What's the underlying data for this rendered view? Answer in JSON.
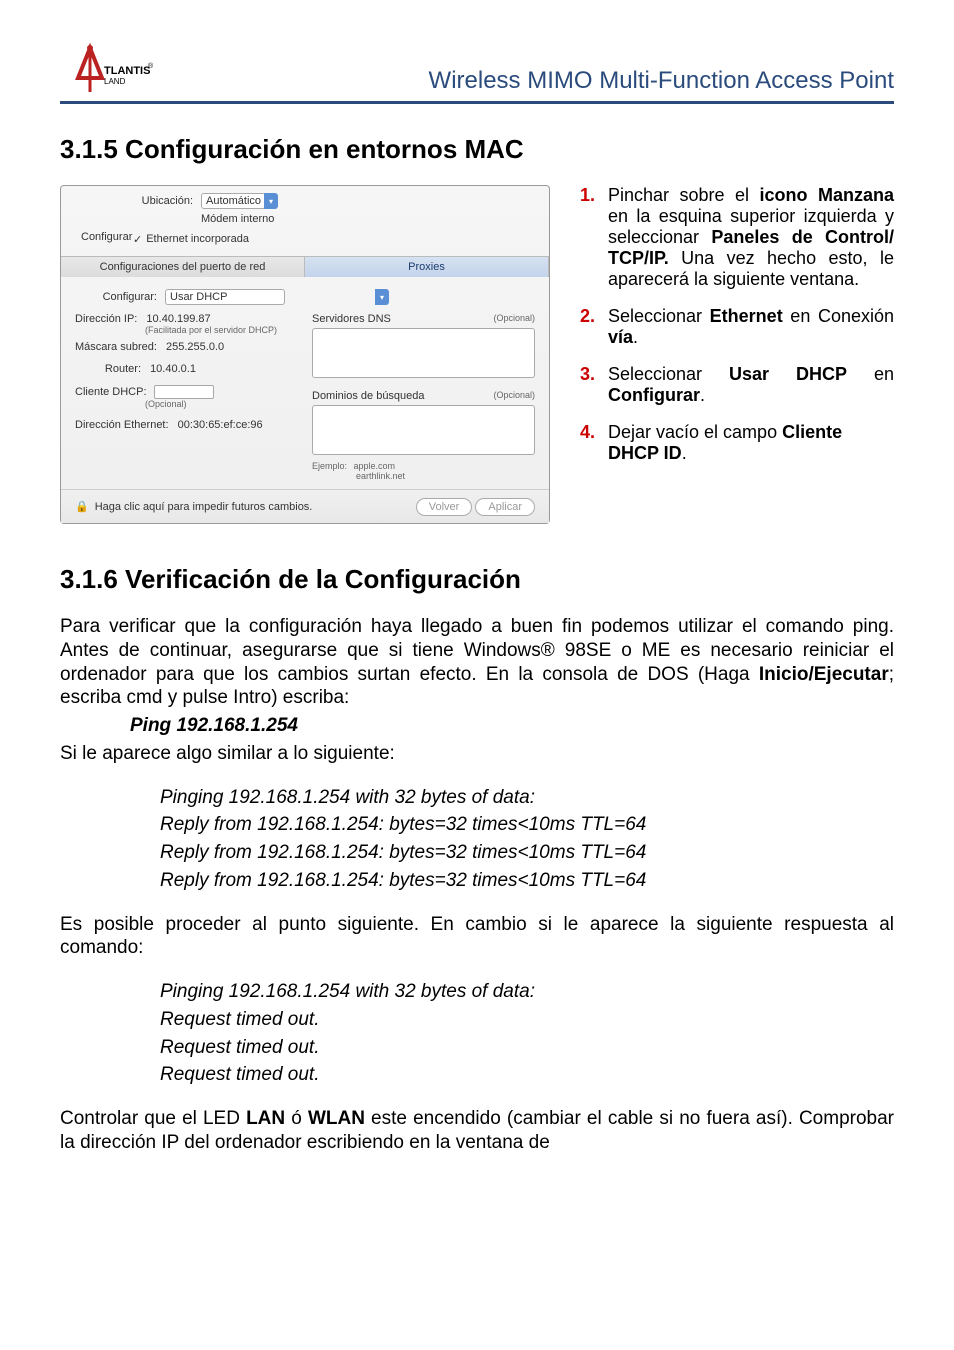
{
  "header": {
    "logoBrand": "ATLANTIS",
    "logoSub": "LAND",
    "title": "Wireless MIMO Multi-Function Access Point"
  },
  "section315": {
    "heading": "3.1.5 Configuración en entornos MAC"
  },
  "mac": {
    "ubicacionLabel": "Ubicación:",
    "ubicacionValue": "Automático",
    "modemLabel": "Módem interno",
    "configurarLabel": "Configurar",
    "ethernetOption": "Ethernet incorporada",
    "tabConfig": "Configuraciones del puerto de red",
    "tabProxies": "Proxies",
    "configurar2Label": "Configurar:",
    "usarDhcp": "Usar DHCP",
    "servidoresDns": "Servidores DNS",
    "opcional": "(Opcional)",
    "direccionIpLabel": "Dirección IP:",
    "direccionIpValue": "10.40.199.87",
    "facilitada": "(Facilitada por el servidor DHCP)",
    "mascaraLabel": "Máscara subred:",
    "mascaraValue": "255.255.0.0",
    "routerLabel": "Router:",
    "routerValue": "10.40.0.1",
    "clienteDhcp": "Cliente DHCP:",
    "dominiosBusqueda": "Dominios de búsqueda",
    "ejemploLabel": "Ejemplo:",
    "ejemplo1": "apple.com",
    "ejemplo2": "earthlink.net",
    "direccionEthLabel": "Dirección Ethernet:",
    "direccionEthValue": "00:30:65:ef:ce:96",
    "lockText": "Haga clic aquí para impedir futuros cambios.",
    "btnVolver": "Volver",
    "btnAplicar": "Aplicar"
  },
  "steps": {
    "s1a": "Pinchar sobre el ",
    "s1b": "icono Manzana",
    "s1c": " en la esquina superior izquierda y seleccionar ",
    "s1d": "Paneles de Control/ TCP/IP.",
    "s1e": " Una vez hecho esto, le aparecerá la siguiente ventana.",
    "s2a": "Seleccionar ",
    "s2b": "Ethernet",
    "s2c": " en Conexión ",
    "s2d": "vía",
    "s2e": ".",
    "s3a": "Seleccionar ",
    "s3b": "Usar DHCP",
    "s3c": " en ",
    "s3d": "Configurar",
    "s3e": ".",
    "s4a": "Dejar vacío el campo ",
    "s4b": "Cliente DHCP ID",
    "s4c": "."
  },
  "section316": {
    "heading": "3.1.6 Verificación de la Configuración",
    "p1a": "Para verificar que la configuración haya llegado a buen fin podemos utilizar el comando ping. Antes de continuar, asegurarse que si tiene Windows® 98SE o ME es necesario reiniciar el ordenador para que los cambios surtan efecto. En la consola de DOS (Haga ",
    "p1b": "Inicio/Ejecutar",
    "p1c": "; escriba cmd y pulse Intro) escriba:",
    "pingCmd": "Ping 192.168.1.254",
    "p2": "Si le aparece algo similar a lo siguiente:",
    "pingHeader": "Pinging 192.168.1.254 with 32 bytes of data:",
    "pingReply": "Reply from 192.168.1.254: bytes=32 times<10ms TTL=64",
    "p3": "Es posible proceder al punto siguiente. En cambio si le aparece la siguiente respuesta al comando:",
    "timeout": "Request timed out.",
    "p4a": "Controlar que el LED ",
    "p4b": "LAN",
    "p4c": " ó ",
    "p4d": "WLAN",
    "p4e": " este encendido (cambiar el cable si no fuera así). Comprobar la dirección IP del ordenador escribiendo en la ventana de"
  }
}
